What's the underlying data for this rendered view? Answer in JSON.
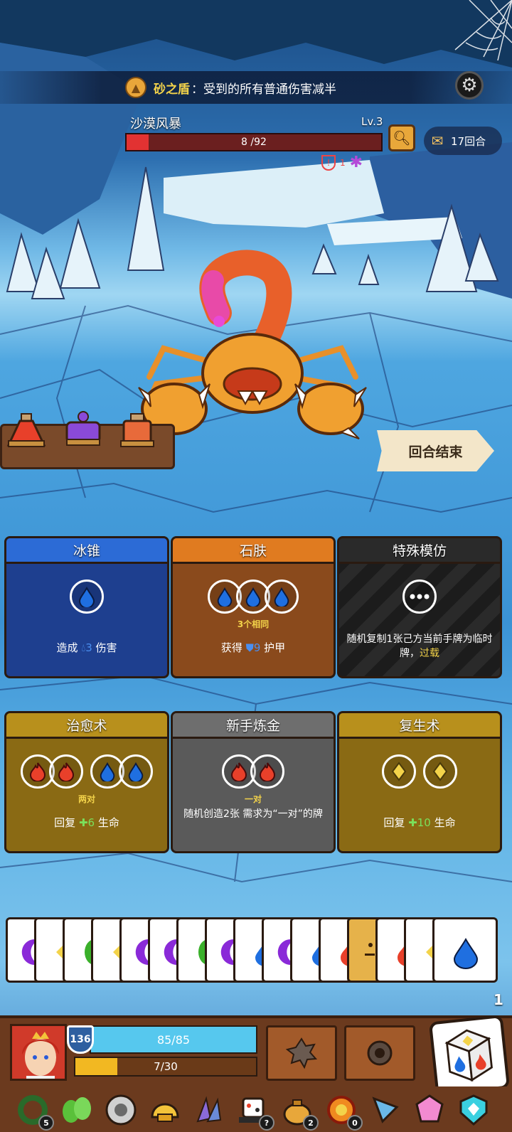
{
  "banner": {
    "buff_name": "砂之盾",
    "buff_desc": "：受到的所有普通伤害减半"
  },
  "enemy": {
    "name": "沙漠风暴",
    "level": "Lv.3",
    "hp_text": "8 /92",
    "hp_fraction": 0.087,
    "debuff_count": "1"
  },
  "turn": {
    "label": "17回合"
  },
  "end_turn": {
    "label": "回合结束"
  },
  "cards": [
    {
      "title": "冰锥",
      "req": "",
      "effect_pre": "造成 ",
      "effect_num": "3",
      "effect_post": " 伤害"
    },
    {
      "title": "石肤",
      "req": "3个相同",
      "effect_pre": "获得 ",
      "effect_num": "9",
      "effect_post": " 护甲"
    },
    {
      "title": "特殊模仿",
      "req": "",
      "effect_pre": "随机复制1张己方当前手牌为临时牌，",
      "effect_num": "过载",
      "effect_post": ""
    },
    {
      "title": "治愈术",
      "req": "两对",
      "effect_pre": "回复 ",
      "effect_num": "6",
      "effect_post": " 生命"
    },
    {
      "title": "新手炼金",
      "req": "一对",
      "effect_pre": "随机创造2张 需求为“一对”的牌",
      "effect_num": "",
      "effect_post": ""
    },
    {
      "title": "复生术",
      "req": "",
      "effect_pre": "回复 ",
      "effect_num": "10",
      "effect_post": " 生命"
    }
  ],
  "hand": {
    "count": "1"
  },
  "player": {
    "armor": "136",
    "hp_text": "85/85",
    "xp_text": "7/30",
    "xp_fraction": 0.233
  },
  "relics": [
    {
      "name": "wreath-relic",
      "badge": "5"
    },
    {
      "name": "leaf-relic",
      "badge": ""
    },
    {
      "name": "gear-relic",
      "badge": ""
    },
    {
      "name": "helmet-relic",
      "badge": ""
    },
    {
      "name": "claw-relic",
      "badge": ""
    },
    {
      "name": "dice-hat-relic",
      "badge": "?"
    },
    {
      "name": "bag-relic",
      "badge": "2"
    },
    {
      "name": "fire-ring-relic",
      "badge": "0"
    },
    {
      "name": "drill-relic",
      "badge": ""
    },
    {
      "name": "crystal-die-relic",
      "badge": ""
    },
    {
      "name": "gem-shield-relic",
      "badge": ""
    }
  ],
  "colors": {
    "water": "#1f6fe0",
    "fire": "#e8402a",
    "gold": "#f3d34a",
    "green": "#3ab02a",
    "purple": "#8a2ad8"
  }
}
